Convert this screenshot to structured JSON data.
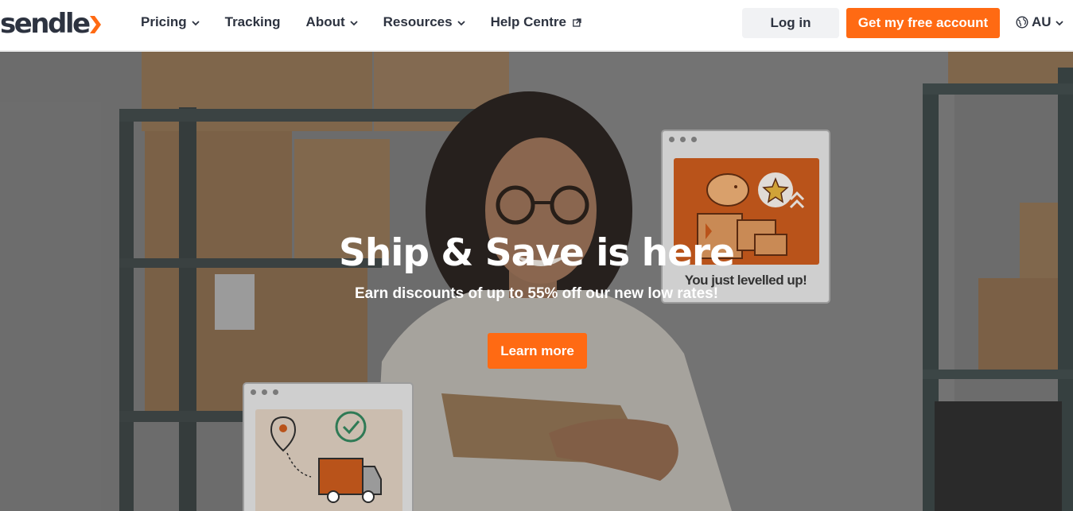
{
  "brand": {
    "name": "sendle",
    "accent": "#ff6a13",
    "text": "#2d3340"
  },
  "nav": {
    "items": [
      {
        "label": "Pricing",
        "has_dropdown": true
      },
      {
        "label": "Tracking",
        "has_dropdown": false
      },
      {
        "label": "About",
        "has_dropdown": true
      },
      {
        "label": "Resources",
        "has_dropdown": true
      },
      {
        "label": "Help Centre",
        "external": true
      }
    ],
    "login_label": "Log in",
    "signup_label": "Get my free account",
    "locale_label": "AU"
  },
  "hero": {
    "title": "Ship & Save is here",
    "subtitle": "Earn discounts of up to 55% off our new low rates!",
    "cta_label": "Learn more",
    "card_caption": "You just levelled up!"
  },
  "icons": [
    "chevron-down-icon",
    "external-link-icon",
    "globe-icon",
    "location-pin-icon",
    "check-circle-icon",
    "truck-icon",
    "piggy-bank-icon",
    "star-badge-icon"
  ]
}
